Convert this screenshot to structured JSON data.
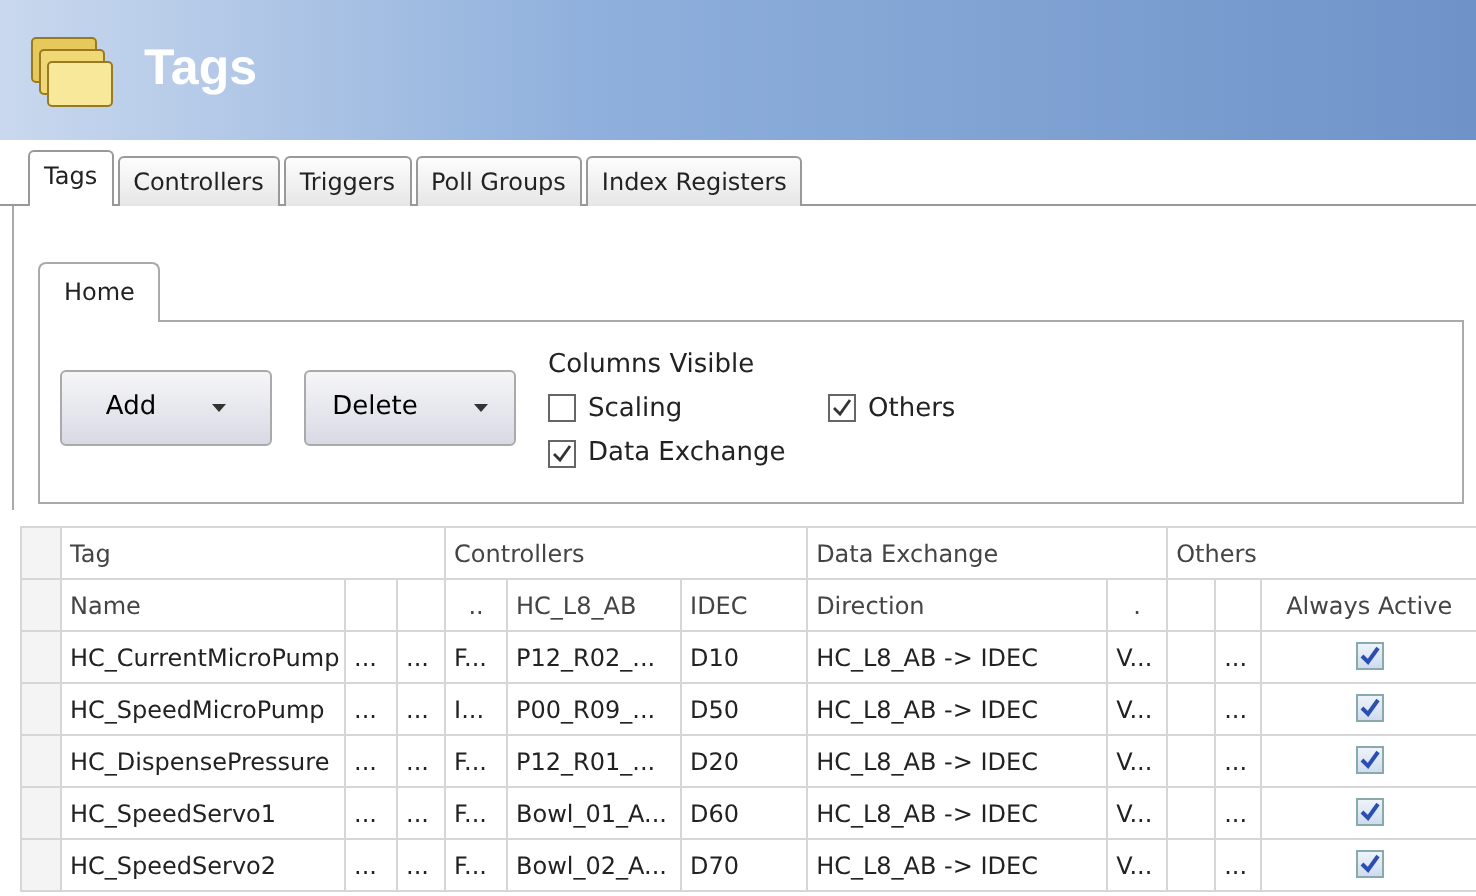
{
  "window": {
    "title": "Tags"
  },
  "tabs": [
    {
      "label": "Tags",
      "selected": true
    },
    {
      "label": "Controllers",
      "selected": false
    },
    {
      "label": "Triggers",
      "selected": false
    },
    {
      "label": "Poll Groups",
      "selected": false
    },
    {
      "label": "Index Registers",
      "selected": false
    }
  ],
  "ribbon": {
    "tabs": [
      {
        "label": "Home",
        "selected": true
      }
    ],
    "buttons": [
      {
        "label": "Add"
      },
      {
        "label": "Delete"
      }
    ],
    "columns_visible": {
      "title": "Columns Visible",
      "options": [
        {
          "label": "Scaling",
          "checked": false
        },
        {
          "label": "Data Exchange",
          "checked": true
        },
        {
          "label": "Others",
          "checked": true
        }
      ]
    }
  },
  "table": {
    "groups": [
      {
        "label": "Tag"
      },
      {
        "label": "Controllers"
      },
      {
        "label": "Data Exchange"
      },
      {
        "label": "Others"
      }
    ],
    "columns": [
      "Name",
      "",
      "",
      "..",
      "HC_L8_AB",
      "IDEC",
      "Direction",
      ".",
      "",
      "",
      "Always Active"
    ],
    "rows": [
      {
        "cells": [
          "HC_CurrentMicroPump",
          "...",
          "...",
          "F...",
          "P12_R02_...",
          "D10",
          "HC_L8_AB -> IDEC",
          "V...",
          "",
          "..."
        ],
        "always_active": true
      },
      {
        "cells": [
          "HC_SpeedMicroPump",
          "...",
          "...",
          "I...",
          "P00_R09_...",
          "D50",
          "HC_L8_AB -> IDEC",
          "V...",
          "",
          "..."
        ],
        "always_active": true
      },
      {
        "cells": [
          "HC_DispensePressure",
          "...",
          "...",
          "F...",
          "P12_R01_...",
          "D20",
          "HC_L8_AB -> IDEC",
          "V...",
          "",
          "..."
        ],
        "always_active": true
      },
      {
        "cells": [
          "HC_SpeedServo1",
          "...",
          "...",
          "F...",
          "Bowl_01_A...",
          "D60",
          "HC_L8_AB -> IDEC",
          "V...",
          "",
          "..."
        ],
        "always_active": true
      },
      {
        "cells": [
          "HC_SpeedServo2",
          "...",
          "...",
          "F...",
          "Bowl_02_A...",
          "D70",
          "HC_L8_AB -> IDEC",
          "V...",
          "",
          "..."
        ],
        "always_active": true
      }
    ]
  }
}
